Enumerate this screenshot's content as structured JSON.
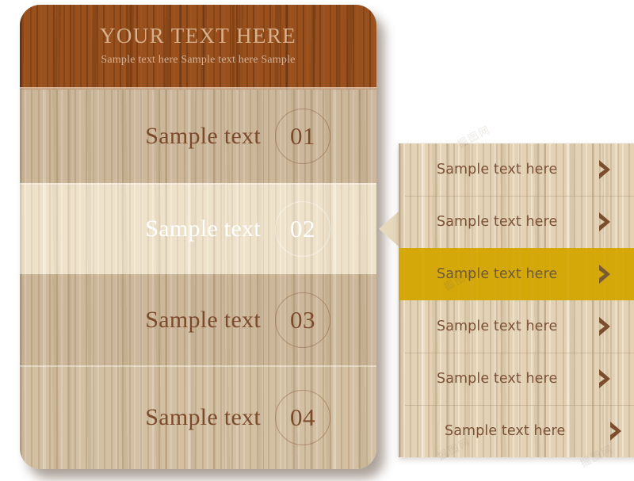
{
  "header": {
    "title": "YOUR TEXT HERE",
    "subtitle": "Sample text here  Sample text here Sample"
  },
  "main_menu": {
    "items": [
      {
        "label": "Sample text",
        "number": "01",
        "active": false
      },
      {
        "label": "Sample text",
        "number": "02",
        "active": true
      },
      {
        "label": "Sample text",
        "number": "03",
        "active": false
      },
      {
        "label": "Sample text",
        "number": "04",
        "active": false
      }
    ]
  },
  "submenu": {
    "items": [
      {
        "label": "Sample text here",
        "active": false
      },
      {
        "label": "Sample text here",
        "active": false
      },
      {
        "label": "Sample text here",
        "active": true
      },
      {
        "label": "Sample text here",
        "active": false
      },
      {
        "label": "Sample text here",
        "active": false
      },
      {
        "label": "Sample text here",
        "active": false
      }
    ],
    "chevron_icon": "chevron-right-icon"
  },
  "watermarks": {
    "top": "掘图网",
    "middle": "掘图网",
    "bottom": "掘图网",
    "bottom_right": "掘图网"
  },
  "colors": {
    "header_wood": "#99501d",
    "body_wood": "#e3d2b6",
    "active_gold": "#d4a80a",
    "text_brown": "#7b4b2b",
    "submenu_text": "#7c5236",
    "header_text": "#d6b18c",
    "active_text": "#ffffff"
  }
}
